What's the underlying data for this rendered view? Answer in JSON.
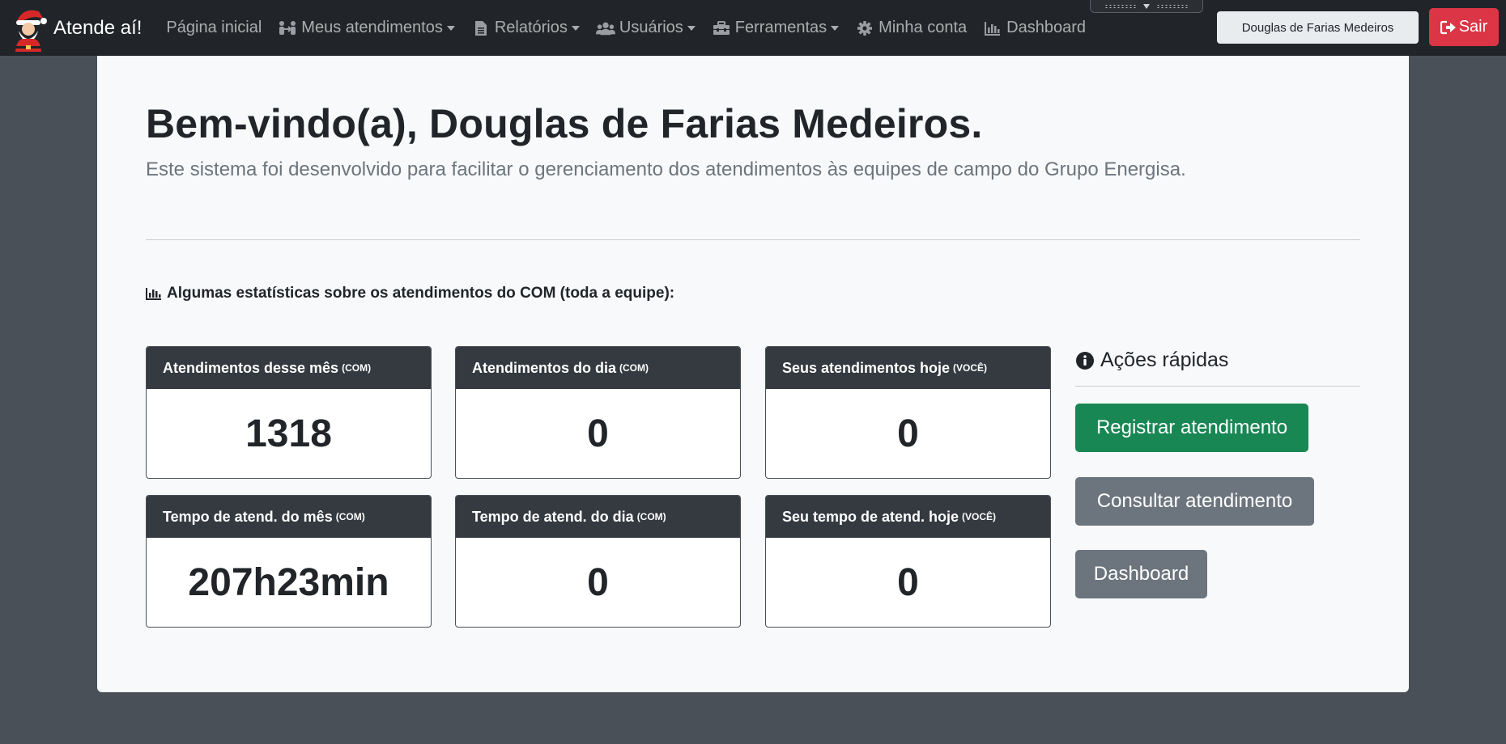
{
  "navbar": {
    "brand": "Atende aí!",
    "items": [
      {
        "label": "Página inicial",
        "icon": null,
        "dropdown": false
      },
      {
        "label": "Meus atendimentos",
        "icon": "people-arrows-icon",
        "dropdown": true
      },
      {
        "label": "Relatórios",
        "icon": "file-icon",
        "dropdown": true
      },
      {
        "label": "Usuários",
        "icon": "users-icon",
        "dropdown": true
      },
      {
        "label": "Ferramentas",
        "icon": "toolbox-icon",
        "dropdown": true
      },
      {
        "label": "Minha conta",
        "icon": "gear-icon",
        "dropdown": false
      },
      {
        "label": "Dashboard",
        "icon": "chart-bar-icon",
        "dropdown": false
      }
    ],
    "user_name": "Douglas de Farias Medeiros",
    "logout_label": "Sair"
  },
  "main": {
    "welcome": "Bem-vindo(a), Douglas de Farias Medeiros.",
    "lead": "Este sistema foi desenvolvido para facilitar o gerenciamento dos atendimentos às equipes de campo do Grupo Energisa.",
    "stats_title": "Algumas estatísticas sobre os atendimentos do COM (toda a equipe):",
    "cards": [
      {
        "title": "Atendimentos desse mês",
        "tag": "(COM)",
        "value": "1318"
      },
      {
        "title": "Atendimentos do dia",
        "tag": "(COM)",
        "value": "0"
      },
      {
        "title": "Seus atendimentos hoje",
        "tag": "(VOCÊ)",
        "value": "0"
      },
      {
        "title": "Tempo de atend. do mês",
        "tag": "(COM)",
        "value": "207h23min"
      },
      {
        "title": "Tempo de atend. do dia",
        "tag": "(COM)",
        "value": "0"
      },
      {
        "title": "Seu tempo de atend. hoje",
        "tag": "(VOCÊ)",
        "value": "0"
      }
    ]
  },
  "quick_actions": {
    "title": "Ações rápidas",
    "buttons": [
      "Registrar atendimento",
      "Consultar atendimento",
      "Dashboard"
    ]
  },
  "colors": {
    "navbar": "#212529",
    "success": "#198754",
    "secondary": "#6c757d",
    "danger": "#dc3545"
  }
}
